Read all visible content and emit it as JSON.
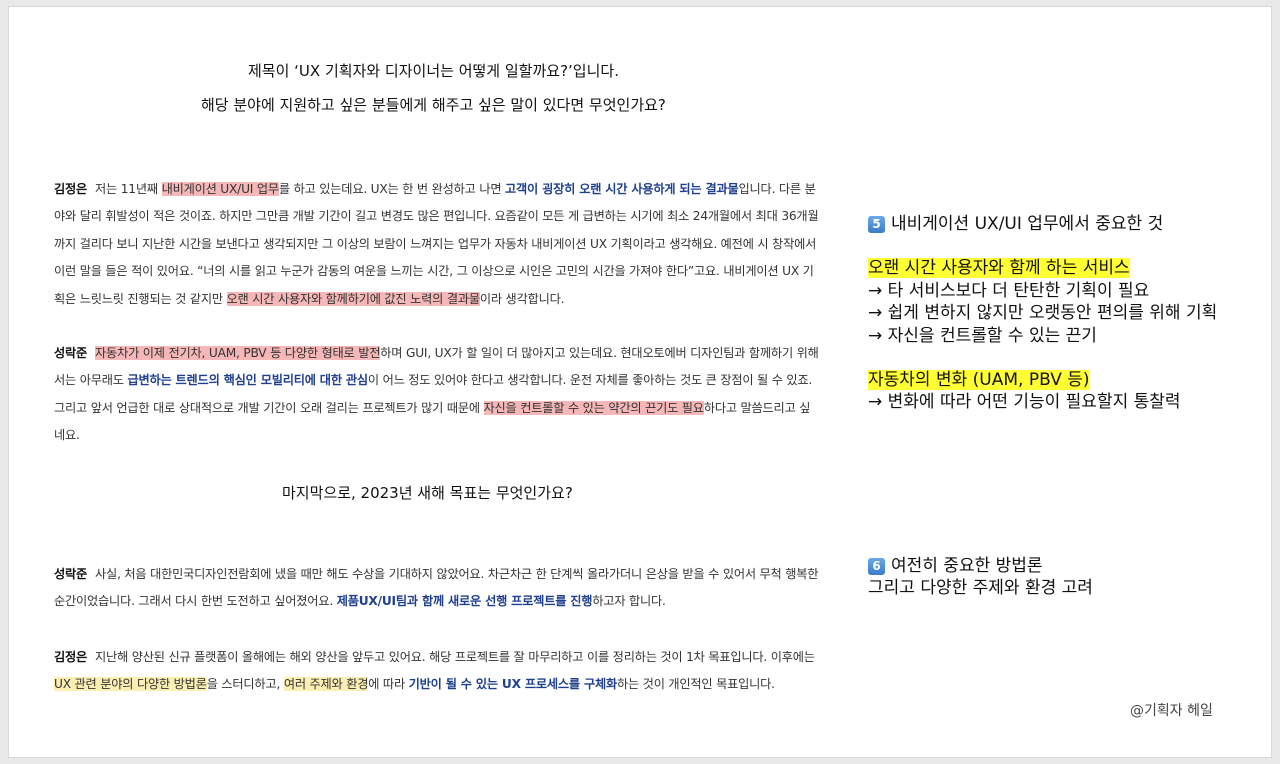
{
  "questions": {
    "q1_line1": "제목이 ‘UX 기획자와 디자이너는 어떻게 일할까요?’입니다.",
    "q1_line2": "해당 분야에 지원하고 싶은 분들에게 해주고 싶은 말이 있다면 무엇인가요?",
    "q2": "마지막으로, 2023년 새해 목표는 무엇인가요?"
  },
  "para1": {
    "speaker": "김정은",
    "t1": "저는 11년째 ",
    "h1": "내비게이션 UX/UI 업무",
    "t2": "를 하고 있는데요. UX는 한 번 완성하고 나면 ",
    "b1": "고객이 굉장히 오랜 시간 사용하게 되는 결과물",
    "t3": "입니다. 다른 분야와 달리 휘발성이 적은 것이죠. 하지만 그만큼 개발 기간이 길고 변경도 많은 편입니다. 요즘같이 모든 게 급변하는 시기에 최소 24개월에서 최대 36개월까지 걸리다 보니 지난한 시간을 보낸다고 생각되지만 그 이상의 보람이 느껴지는 업무가 자동차 내비게이션 UX 기획이라고 생각해요. 예전에 시 창작에서 이런 말을 들은 적이 있어요. “너의 시를 읽고 누군가 감동의 여운을 느끼는 시간, 그 이상으로 시인은 고민의 시간을 가져야 한다”고요. 내비게이션 UX 기획은 느릿느릿 진행되는 것 같지만 ",
    "h2": "오랜 시간 사용자와 함께하기에 값진 노력의 결과물",
    "t4": "이라 생각합니다."
  },
  "para2": {
    "speaker": "성락준",
    "h1": "자동차가 이제 전기차, UAM, PBV 등 다양한 형태로 발전",
    "t1": "하며 GUI, UX가 할 일이 더 많아지고 있는데요. 현대오토에버 디자인팀과 함께하기 위해서는 아무래도 ",
    "b1": "급변하는 트렌드의 핵심인 모빌리티에 대한 관심",
    "t2": "이 어느 정도 있어야 한다고 생각합니다. 운전 자체를 좋아하는 것도 큰 장점이 될 수 있죠. 그리고 앞서 언급한 대로 상대적으로 개발 기간이 오래 걸리는 프로젝트가 많기 때문에 ",
    "h2": "자신을 컨트롤할 수 있는 약간의 끈기도 필요",
    "t3": "하다고 말씀드리고 싶네요."
  },
  "para3": {
    "speaker": "성락준",
    "t1": "사실, 처음 대한민국디자인전람회에 냈을 때만 해도 수상을 기대하지 않았어요. 차근차근 한 단계씩 올라가더니 은상을 받을 수 있어서 무척 행복한 순간이었습니다. 그래서 다시 한번 도전하고 싶어졌어요. ",
    "b1": "제품UX/UI팀과 함께 새로운 선행 프로젝트를 진행",
    "t2": "하고자 합니다."
  },
  "para4": {
    "speaker": "김정은",
    "t1": "지난해 양산된 신규 플랫폼이 올해에는 해외 양산을 앞두고 있어요. 해당 프로젝트를 잘 마무리하고 이를 정리하는 것이 1차 목표입니다. 이후에는 ",
    "y1": "UX 관련 분야의 다양한 방법론",
    "t2": "을 스터디하고, ",
    "y2": "여러 주제와 환경",
    "t3": "에 따라 ",
    "b1": "기반이 될 수 있는 UX 프로세스를 구체화",
    "t4": "하는 것이 개인적인 목표입니다."
  },
  "note5": {
    "badge": "5",
    "title": "내비게이션 UX/UI 업무에서 중요한 것",
    "hl1": "오랜 시간 사용자와 함께 하는 서비스",
    "l1": "→ 타 서비스보다 더 탄탄한 기획이 필요",
    "l2": "→ 쉽게 변하지 않지만 오랫동안 편의를 위해 기획",
    "l3": "→ 자신을 컨트롤할 수 있는 끈기",
    "hl2": "자동차의 변화 (UAM, PBV 등)",
    "l4": "→ 변화에 따라 어떤 기능이 필요할지 통찰력"
  },
  "note6": {
    "badge": "6",
    "title": "여전히 중요한 방법론",
    "l1": "그리고 다양한 주제와 환경 고려"
  },
  "credit": "@기획자 헤일",
  "colors": {
    "pink_highlight": "#f5b7b7",
    "yellow_highlight": "#fbefb3",
    "marker_yellow": "#ffff33",
    "emphasis_blue": "#1f3f8f",
    "badge_blue": "#3b7cc9"
  }
}
